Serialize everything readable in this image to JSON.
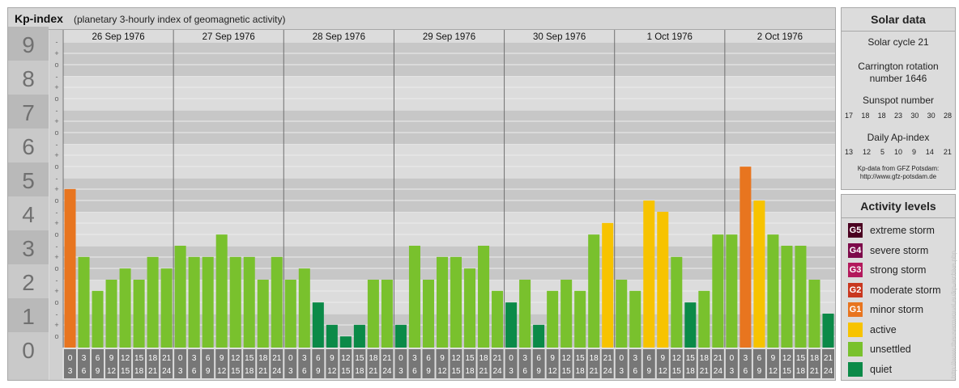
{
  "header": {
    "title": "Kp-index",
    "subtitle": "(planetary 3-hourly index of geomagnetic activity)"
  },
  "chart_data": {
    "type": "bar",
    "title": "Kp-index",
    "subtitle": "(planetary 3-hourly index of geomagnetic activity)",
    "days": [
      "26 Sep 1976",
      "27 Sep 1976",
      "28 Sep 1976",
      "29 Sep 1976",
      "30 Sep 1976",
      "1 Oct 1976",
      "2 Oct 1976"
    ],
    "interval_start": [
      "0",
      "3",
      "6",
      "9",
      "12",
      "15",
      "18",
      "21"
    ],
    "interval_end": [
      "3",
      "6",
      "9",
      "12",
      "15",
      "18",
      "21",
      "24"
    ],
    "y_ticks": [
      "0",
      "1",
      "2",
      "3",
      "4",
      "5",
      "6",
      "7",
      "8",
      "9"
    ],
    "y_sub_ticks": [
      "-",
      "o",
      "+"
    ],
    "ylim": [
      0,
      9
    ],
    "kp_values": [
      [
        4.67,
        2.67,
        1.67,
        2.0,
        2.33,
        2.0,
        2.67,
        2.33
      ],
      [
        3.0,
        2.67,
        2.67,
        3.33,
        2.67,
        2.67,
        2.0,
        2.67
      ],
      [
        2.0,
        2.33,
        1.33,
        0.67,
        0.33,
        0.67,
        2.0,
        2.0
      ],
      [
        0.67,
        3.0,
        2.0,
        2.67,
        2.67,
        2.33,
        3.0,
        1.67
      ],
      [
        1.33,
        2.0,
        0.67,
        1.67,
        2.0,
        1.67,
        3.33,
        3.67
      ],
      [
        2.0,
        1.67,
        4.33,
        4.0,
        2.67,
        1.33,
        1.67,
        3.33
      ],
      [
        3.33,
        5.33,
        4.33,
        3.33,
        3.0,
        3.0,
        2.0,
        1.0
      ]
    ],
    "color_scale": {
      "quiet": "#0b8a48",
      "unsettled": "#79c12d",
      "active": "#f7c300",
      "G1": "#e8751f",
      "G2": "#c9371f",
      "G3": "#b3195c",
      "G4": "#7d0a4a",
      "G5": "#4a0020"
    }
  },
  "solar": {
    "heading": "Solar data",
    "cycle": "Solar cycle 21",
    "carrington_line1": "Carrington rotation",
    "carrington_line2": "number 1646",
    "sunspot_label": "Sunspot number",
    "sunspot_values": [
      "17",
      "18",
      "18",
      "23",
      "30",
      "30",
      "28"
    ],
    "ap_label": "Daily Ap-index",
    "ap_values": [
      "13",
      "12",
      "5",
      "10",
      "9",
      "14",
      "21"
    ],
    "credit_line1": "Kp-data from GFZ Potsdam:",
    "credit_line2": "http://www.gfz-potsdam.de"
  },
  "activity": {
    "heading": "Activity levels",
    "levels": [
      {
        "code": "G5",
        "label": "extreme storm",
        "color": "#4a0020"
      },
      {
        "code": "G4",
        "label": "severe storm",
        "color": "#7d0a4a"
      },
      {
        "code": "G3",
        "label": "strong storm",
        "color": "#b3195c"
      },
      {
        "code": "G2",
        "label": "moderate storm",
        "color": "#c9371f"
      },
      {
        "code": "G1",
        "label": "minor storm",
        "color": "#e8751f"
      },
      {
        "code": "",
        "label": "active",
        "color": "#f7c300"
      },
      {
        "code": "",
        "label": "unsettled",
        "color": "#79c12d"
      },
      {
        "code": "",
        "label": "quiet",
        "color": "#0b8a48"
      }
    ]
  },
  "watermark": "http://www.theusermanual.eu/kp-archive.php"
}
